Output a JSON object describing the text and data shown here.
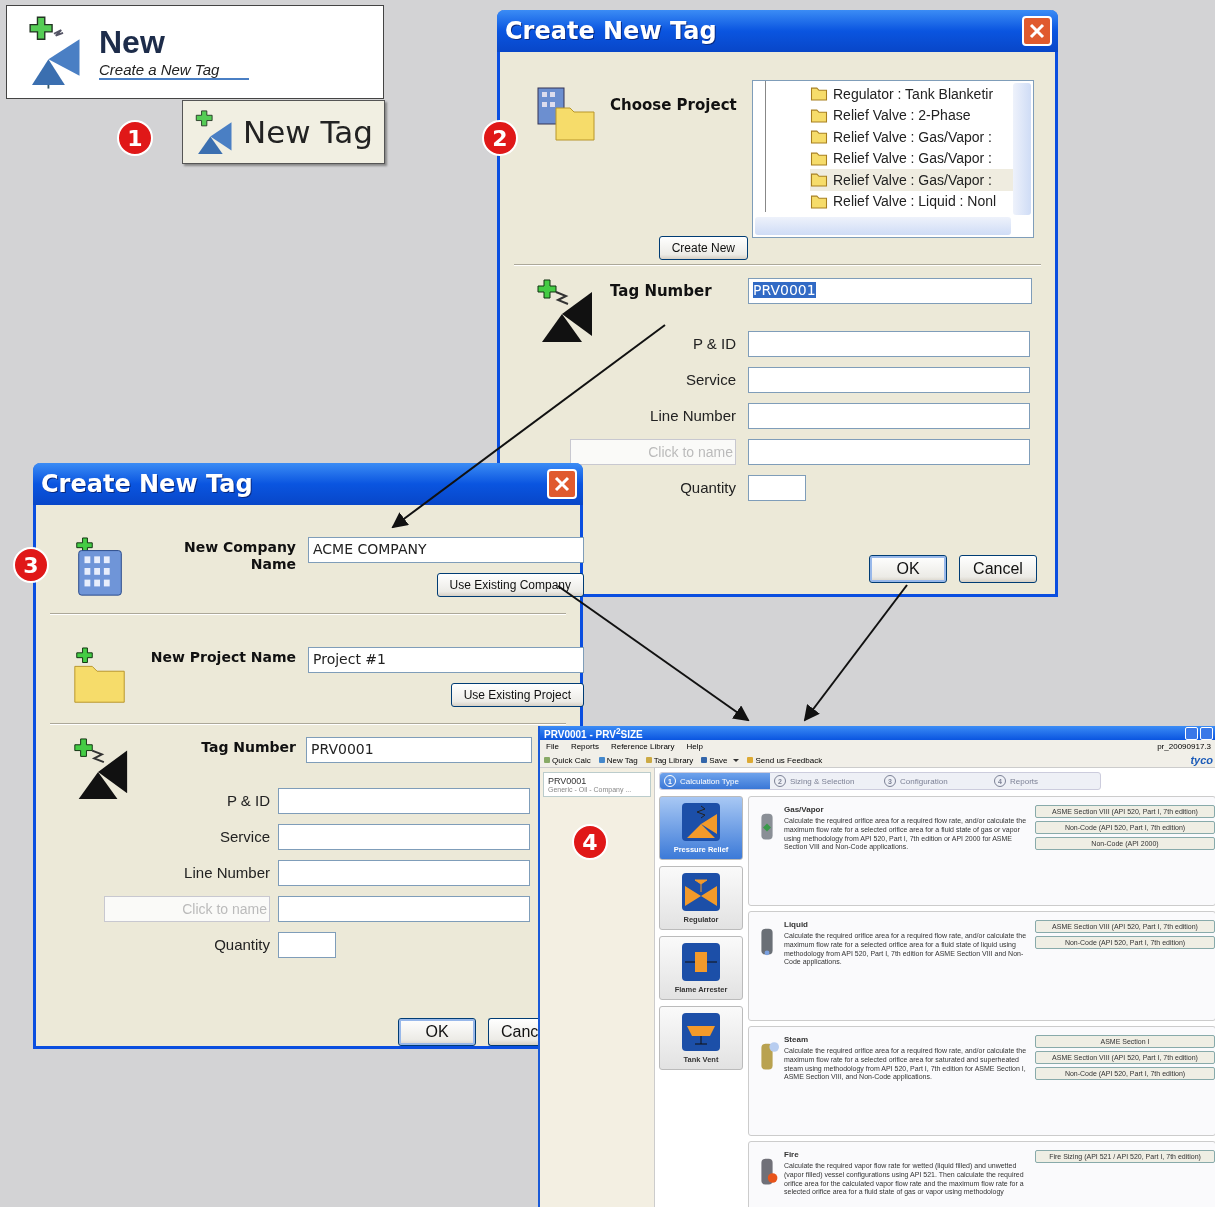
{
  "callout": {
    "title": "New",
    "subtitle": "Create a New Tag",
    "button": "New Tag"
  },
  "badges": [
    "1",
    "2",
    "3",
    "4"
  ],
  "project_dialog": {
    "title": "Create New Tag",
    "choose_label": "Choose Project",
    "projects": [
      {
        "label": "Regulator : Tank Blanketir",
        "selected": false
      },
      {
        "label": "Relief Valve : 2-Phase",
        "selected": false
      },
      {
        "label": "Relief Valve : Gas/Vapor :",
        "selected": false
      },
      {
        "label": "Relief Valve : Gas/Vapor :",
        "selected": false
      },
      {
        "label": "Relief Valve : Gas/Vapor :",
        "selected": true
      },
      {
        "label": "Relief Valve : Liquid : Nonl",
        "selected": false
      }
    ],
    "create_button": "Create New",
    "tag_label": "Tag Number",
    "tag_value": "PRV0001",
    "fields": [
      {
        "kind": "label",
        "label": "P & ID"
      },
      {
        "kind": "label",
        "label": "Service"
      },
      {
        "kind": "label",
        "label": "Line Number"
      },
      {
        "kind": "named",
        "placeholder": "Click to name"
      },
      {
        "kind": "short",
        "label": "Quantity"
      }
    ],
    "buttons": [
      "OK",
      "Cancel"
    ]
  },
  "company_dialog": {
    "title": "Create New Tag",
    "company_label": "New Company Name",
    "company_value": "ACME COMPANY",
    "company_button": "Use Existing Company",
    "project_label": "New Project Name",
    "project_value": "Project #1",
    "project_button": "Use Existing Project",
    "tag_label": "Tag Number",
    "tag_value": "PRV0001",
    "fields": [
      {
        "kind": "label",
        "label": "P & ID"
      },
      {
        "kind": "label",
        "label": "Service"
      },
      {
        "kind": "label",
        "label": "Line Number"
      },
      {
        "kind": "named",
        "placeholder": "Click to name"
      },
      {
        "kind": "short",
        "label": "Quantity"
      }
    ],
    "buttons": [
      "OK",
      "Canc"
    ]
  },
  "app": {
    "title": "PRV0001 - PRV$^{2}$SIZE",
    "menu": [
      "File",
      "Reports",
      "Reference Library",
      "Help"
    ],
    "version": "pr_20090917.3",
    "toolbar": [
      {
        "kind": "calc",
        "label": "Quick Calc"
      },
      {
        "kind": "tag",
        "label": "New Tag"
      },
      {
        "kind": "library",
        "label": "Tag Library"
      },
      {
        "kind": "save",
        "label": "Save"
      },
      {
        "kind": "feedback",
        "label": "Send us Feedback"
      }
    ],
    "logo": "tyco",
    "tag": {
      "name": "PRV0001",
      "detail": "Generic - Oil - Company ..."
    },
    "steps": [
      {
        "number": "1",
        "label": "Calculation Type",
        "selected": true
      },
      {
        "number": "2",
        "label": "Sizing & Selection",
        "selected": false
      },
      {
        "number": "3",
        "label": "Configuration",
        "selected": false
      },
      {
        "number": "4",
        "label": "Reports",
        "selected": false
      }
    ],
    "categories": [
      {
        "kind": "relief",
        "label": "Pressure Relief",
        "selected": true
      },
      {
        "kind": "regulator",
        "label": "Regulator",
        "selected": false
      },
      {
        "kind": "arrester",
        "label": "Flame Arrester",
        "selected": false
      },
      {
        "kind": "vent",
        "label": "Tank Vent",
        "selected": false
      }
    ],
    "calc_types": [
      {
        "kind": "gas",
        "title": "Gas/Vapor",
        "description": "Calculate the required orifice area for a required flow rate, and/or calculate the maximum flow rate for a selected orifice area for a fluid state of gas or vapor using methodology from API 520, Part I, 7th edition or API 2000 for ASME Section VIII and Non-Code applications.",
        "options": [
          "ASME Section VIII (API 520, Part I, 7th edition)",
          "Non-Code (API 520, Part I, 7th edition)",
          "Non-Code (API 2000)"
        ]
      },
      {
        "kind": "liquid",
        "title": "Liquid",
        "description": "Calculate the required orifice area for a required flow rate, and/or calculate the maximum flow rate for a selected orifice area for a fluid state of liquid using methodology from API 520, Part I, 7th edition for ASME Section VIII and Non-Code applications.",
        "options": [
          "ASME Section VIII (API 520, Part I, 7th edition)",
          "Non-Code (API 520, Part I, 7th edition)"
        ]
      },
      {
        "kind": "steam",
        "title": "Steam",
        "description": "Calculate the required orifice area for a required flow rate, and/or calculate the maximum flow rate for a selected orifice area for saturated and superheated steam using methodology from API 520, Part I, 7th edition for ASME Section I, ASME Section VIII, and Non-Code applications.",
        "options": [
          "ASME Section I",
          "ASME Section VIII (API 520, Part I, 7th edition)",
          "Non-Code (API 520, Part I, 7th edition)"
        ]
      },
      {
        "kind": "fire",
        "title": "Fire",
        "description": "Calculate the required vapor flow rate for wetted (liquid filled) and unwetted (vapor filled) vessel configurations using API 521. Then calculate the required orifice area for the calculated vapor flow rate and the maximum flow rate for a selected orifice area for a fluid state of gas or vapor using methodology",
        "options": [
          "Fire Sizing (API 521 / API 520, Part I, 7th edition)"
        ]
      }
    ]
  }
}
